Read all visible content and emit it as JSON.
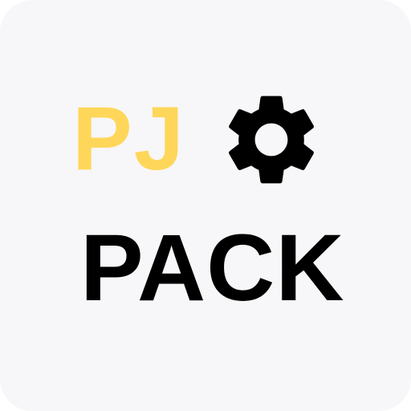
{
  "logo": {
    "top_word": "PJ",
    "bottom_word": "PACK",
    "icon": "gear-icon",
    "colors": {
      "background": "#f7f7f9",
      "accent": "#fed75a",
      "text": "#000000"
    }
  }
}
